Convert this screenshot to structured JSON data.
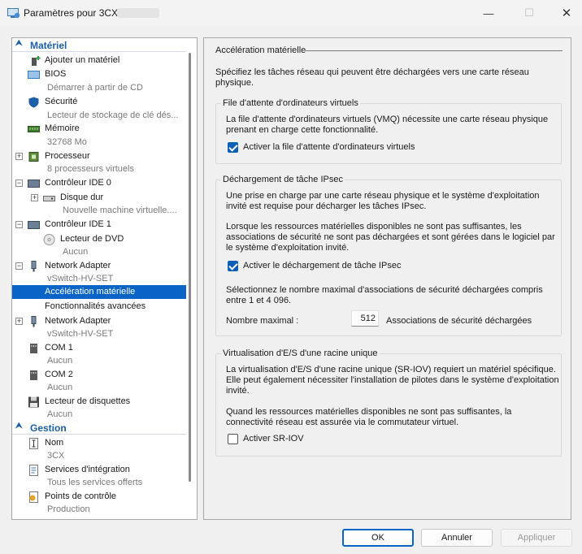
{
  "window": {
    "title": "Paramètres pour 3CX",
    "minimize": "—",
    "maximize": "☐",
    "close": "✕"
  },
  "tree": {
    "sections": {
      "hardware": "Matériel",
      "management": "Gestion"
    },
    "items": [
      {
        "label": "Ajouter un matériel"
      },
      {
        "label": "BIOS",
        "sub": "Démarrer à partir de CD"
      },
      {
        "label": "Sécurité",
        "sub": "Lecteur de stockage de clé dés..."
      },
      {
        "label": "Mémoire",
        "sub": "32768 Mo"
      },
      {
        "label": "Processeur",
        "sub": "8 processeurs virtuels"
      },
      {
        "label": "Contrôleur IDE 0"
      },
      {
        "label": "Disque dur",
        "sub": "Nouvelle machine virtuelle...."
      },
      {
        "label": "Contrôleur IDE 1"
      },
      {
        "label": "Lecteur de DVD",
        "sub": "Aucun"
      },
      {
        "label": "Network Adapter",
        "sub": "vSwitch-HV-SET"
      },
      {
        "label": "Accélération matérielle"
      },
      {
        "label": "Fonctionnalités avancées"
      },
      {
        "label": "Network Adapter",
        "sub": "vSwitch-HV-SET"
      },
      {
        "label": "COM 1",
        "sub": "Aucun"
      },
      {
        "label": "COM 2",
        "sub": "Aucun"
      },
      {
        "label": "Lecteur de disquettes",
        "sub": "Aucun"
      },
      {
        "label": "Nom",
        "sub": "3CX"
      },
      {
        "label": "Services d'intégration",
        "sub": "Tous les services offerts"
      },
      {
        "label": "Points de contrôle",
        "sub": "Production"
      }
    ]
  },
  "panel": {
    "title": "Accélération matérielle",
    "intro": "Spécifiez les tâches réseau qui peuvent être déchargées vers une carte réseau physique.",
    "vmq": {
      "title": "File d'attente d'ordinateurs virtuels",
      "desc": "La file d'attente d'ordinateurs virtuels (VMQ) nécessite une carte réseau physique prenant en charge cette fonctionnalité.",
      "checkbox_label": "Activer la file d'attente d'ordinateurs virtuels",
      "checked": true
    },
    "ipsec": {
      "title": "Déchargement de tâche IPsec",
      "desc1": "Une prise en charge par une carte réseau physique et le système d'exploitation invité est requise pour décharger les tâches IPsec.",
      "desc2": "Lorsque les ressources matérielles disponibles ne sont pas suffisantes, les associations de sécurité ne sont pas déchargées et sont gérées dans le logiciel par le système d'exploitation invité.",
      "checkbox_label": "Activer le déchargement de tâche IPsec",
      "checked": true,
      "select_desc": "Sélectionnez le nombre maximal d'associations de sécurité déchargées compris entre 1 et 4 096.",
      "max_label": "Nombre maximal :",
      "max_value": "512",
      "max_suffix": "Associations de sécurité déchargées"
    },
    "sriov": {
      "title": "Virtualisation d'E/S d'une racine unique",
      "desc1": "La virtualisation d'E/S d'une racine unique (SR-IOV) requiert un matériel spécifique. Elle peut également nécessiter l'installation de pilotes dans le système d'exploitation invité.",
      "desc2": "Quand les ressources matérielles disponibles ne sont pas suffisantes, la connectivité réseau est assurée via le commutateur virtuel.",
      "checkbox_label": "Activer SR-IOV",
      "checked": false
    }
  },
  "buttons": {
    "ok": "OK",
    "cancel": "Annuler",
    "apply": "Appliquer"
  },
  "colors": {
    "accent": "#0a64c8",
    "section_header": "#1d5ea8"
  }
}
